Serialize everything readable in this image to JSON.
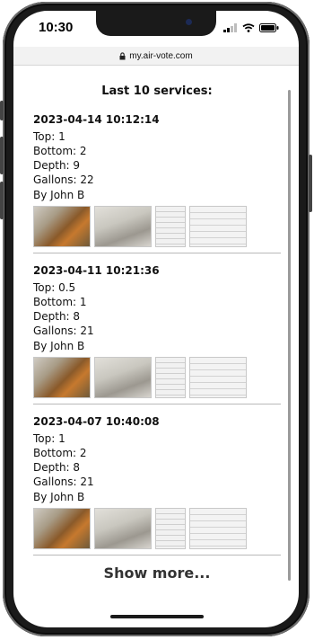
{
  "status": {
    "time": "10:30"
  },
  "browser": {
    "url": "my.air-vote.com"
  },
  "page": {
    "heading": "Last 10 services:",
    "show_more": "Show more..."
  },
  "services": [
    {
      "date": "2023-04-14 10:12:14",
      "top": "Top: 1",
      "bottom": "Bottom: 2",
      "depth": "Depth: 9",
      "gallons": "Gallons: 22",
      "by": "By John B"
    },
    {
      "date": "2023-04-11 10:21:36",
      "top": "Top: 0.5",
      "bottom": "Bottom: 1",
      "depth": "Depth: 8",
      "gallons": "Gallons: 21",
      "by": "By  John B"
    },
    {
      "date": "2023-04-07 10:40:08",
      "top": "Top: 1",
      "bottom": "Bottom: 2",
      "depth": "Depth: 8",
      "gallons": "Gallons: 21",
      "by": "By John B"
    }
  ]
}
